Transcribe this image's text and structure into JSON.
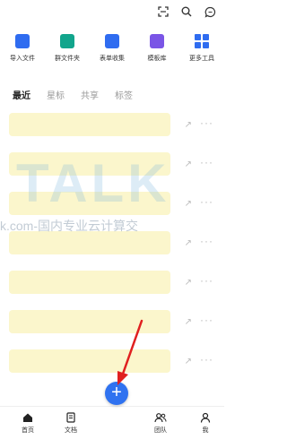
{
  "topbar": {
    "icons": [
      "scan-icon",
      "search-icon",
      "chat-icon"
    ]
  },
  "tools": [
    {
      "label": "导入文件",
      "color": "#2f6cf0",
      "icon": "import-icon"
    },
    {
      "label": "群文件夹",
      "color": "#12a58c",
      "icon": "group-folder-icon"
    },
    {
      "label": "表单收集",
      "color": "#2f6cf0",
      "icon": "form-icon"
    },
    {
      "label": "模板库",
      "color": "#7a55e6",
      "icon": "template-icon"
    },
    {
      "label": "更多工具",
      "color": "#2f6cf0",
      "icon": "more-tools-icon"
    }
  ],
  "tabs": [
    {
      "label": "最近",
      "active": true
    },
    {
      "label": "星标",
      "active": false
    },
    {
      "label": "共享",
      "active": false
    },
    {
      "label": "标签",
      "active": false
    }
  ],
  "watermark": {
    "big": "TALK",
    "sub": "k.com-国内专业云计算交"
  },
  "bottomnav": [
    {
      "label": "首页",
      "icon": "home-icon",
      "glyph": "⬛"
    },
    {
      "label": "文档",
      "icon": "doc-icon",
      "glyph": "▢"
    },
    {
      "label": "团队",
      "icon": "team-icon",
      "glyph": "👥"
    },
    {
      "label": "我",
      "icon": "user-icon",
      "glyph": "◯"
    }
  ],
  "fab": {
    "label": "+"
  },
  "annotation_color": "#e02020"
}
